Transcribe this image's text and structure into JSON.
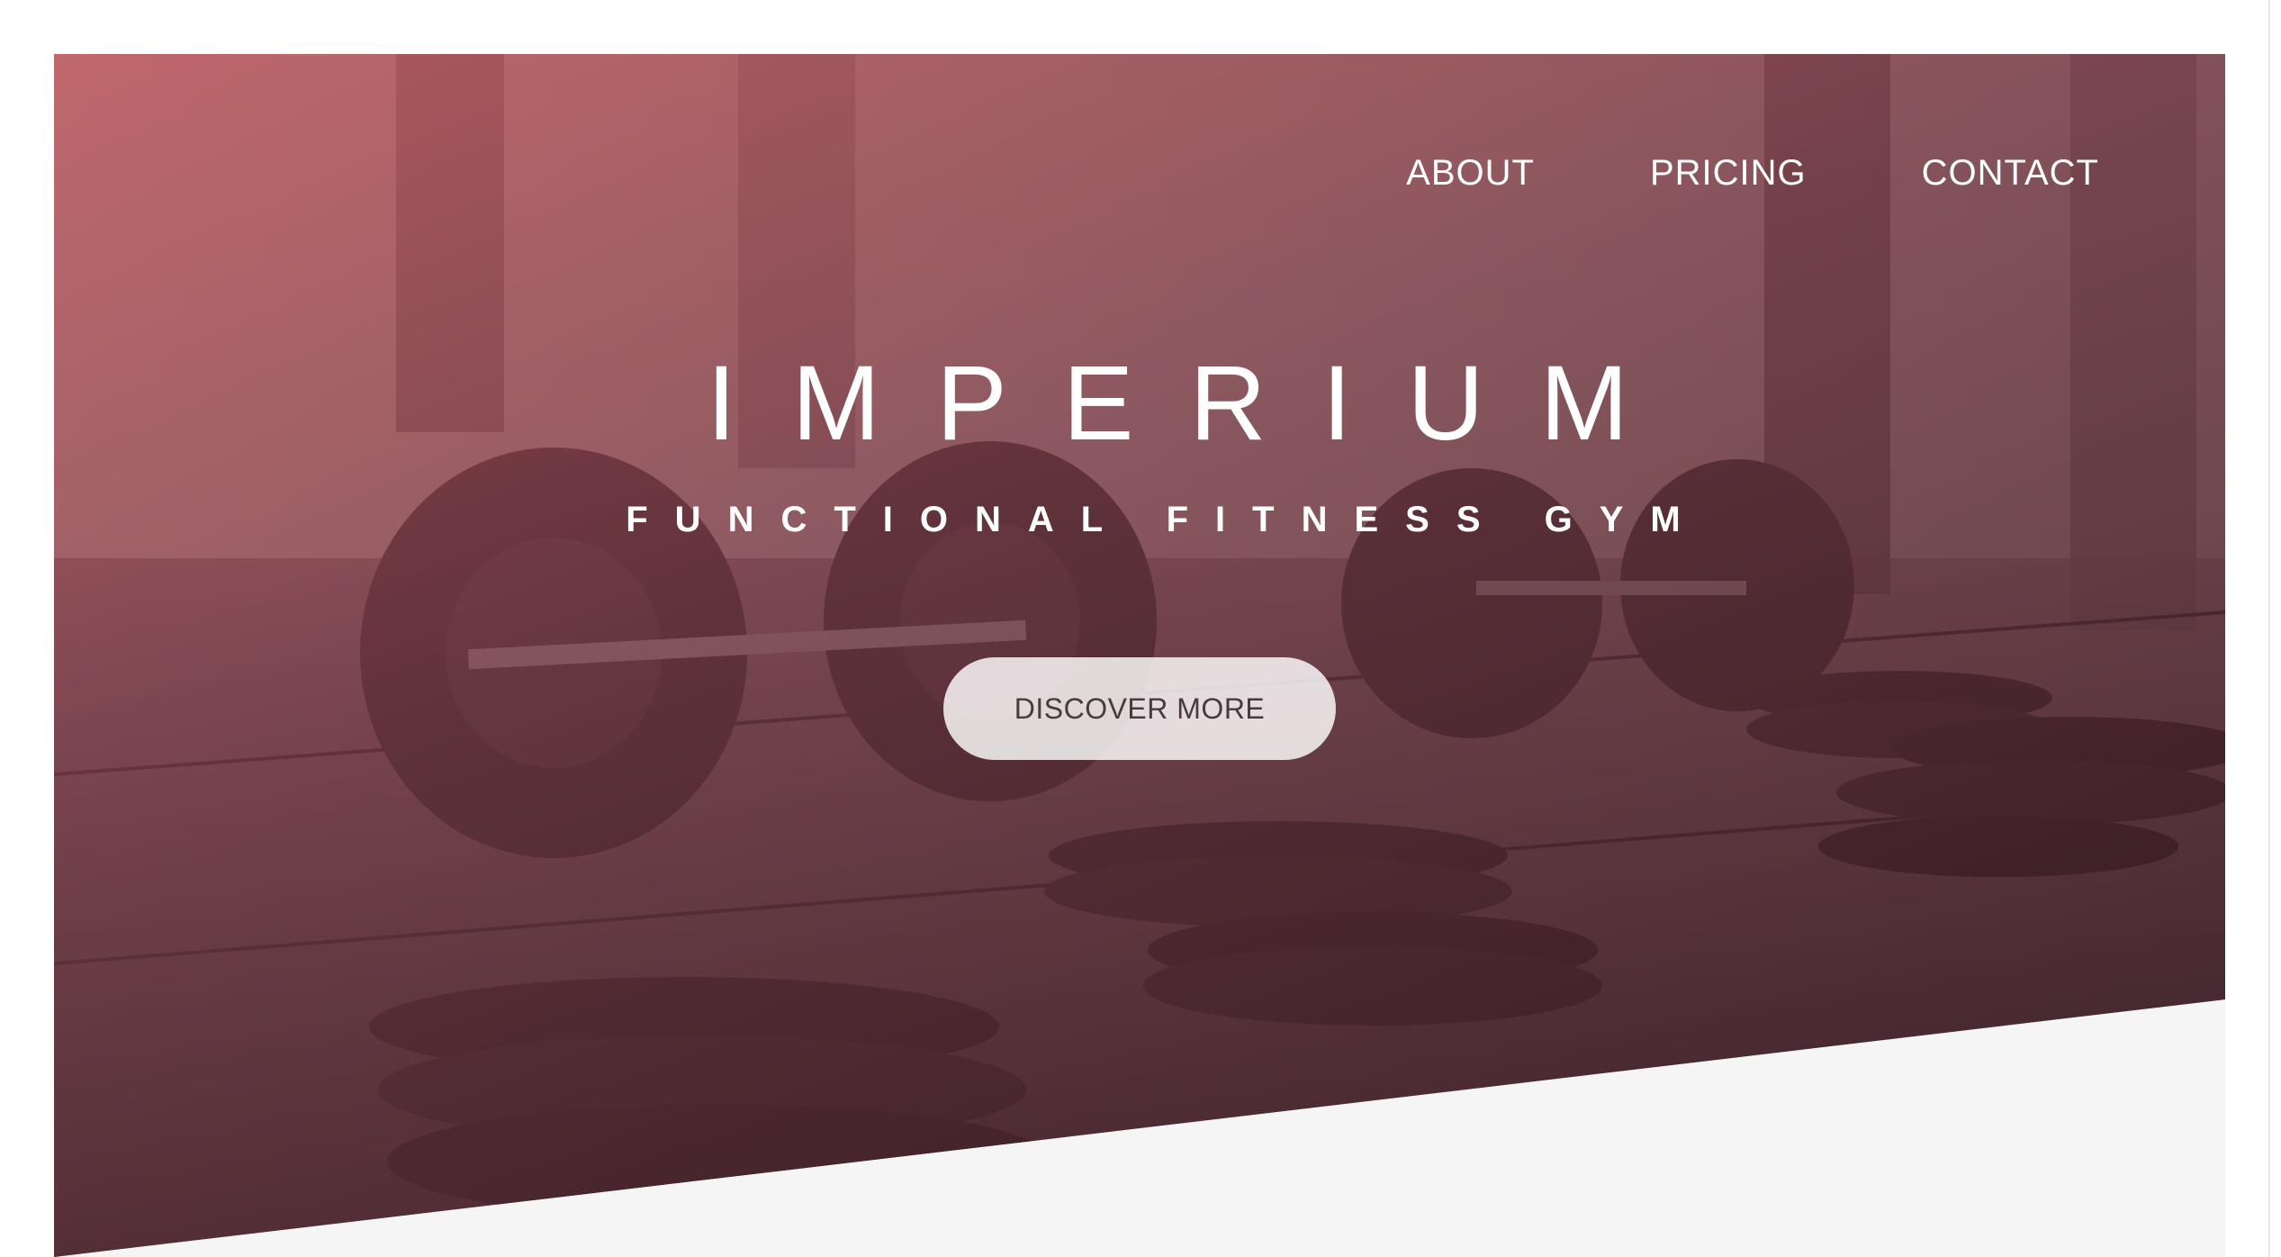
{
  "nav": {
    "items": [
      {
        "label": "ABOUT"
      },
      {
        "label": "PRICING"
      },
      {
        "label": "CONTACT"
      }
    ]
  },
  "hero": {
    "title": "IMPERIUM",
    "subtitle": "FUNCTIONAL FITNESS GYM",
    "cta_label": "DISCOVER MORE",
    "image_subject": "barbell-and-weight-plates-gym-floor"
  },
  "colors": {
    "overlay_top": "#d66068",
    "overlay_bottom": "#3c1923",
    "page_background": "#ffffff",
    "below_hero": "#f5f5f5",
    "text": "#ffffff",
    "cta_text": "#4a3a40"
  }
}
